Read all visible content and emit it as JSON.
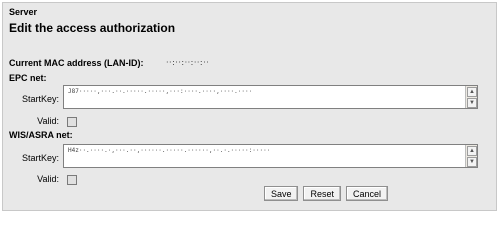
{
  "header": {
    "section": "Server",
    "title": "Edit the access authorization"
  },
  "mac": {
    "label": "Current MAC address (LAN-ID):",
    "value": "··:··:··:··:··"
  },
  "epc": {
    "title": "EPC net:",
    "startkey_label": "StartKey:",
    "startkey_value": "J87·····,···.··.·····.·····,···:····.····,····.····",
    "valid_label": "Valid:"
  },
  "wis": {
    "title": "WIS/ASRA net:",
    "startkey_label": "StartKey:",
    "startkey_value": "H4z··.····.·,···.··,······.·····.······,··.·.·····:·····",
    "valid_label": "Valid:"
  },
  "buttons": {
    "save": "Save",
    "reset": "Reset",
    "cancel": "Cancel"
  }
}
